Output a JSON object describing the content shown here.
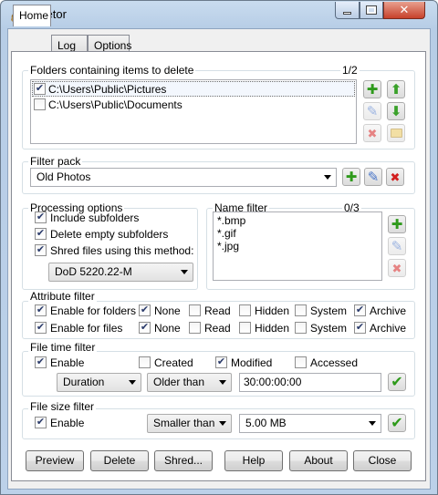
{
  "window": {
    "title": "Deletor"
  },
  "tabs": [
    {
      "label": "Home"
    },
    {
      "label": "Log"
    },
    {
      "label": "Options"
    }
  ],
  "folders": {
    "label": "Folders containing items to delete",
    "count": "1/2",
    "items": [
      {
        "path": "C:\\Users\\Public\\Pictures",
        "checked": true
      },
      {
        "path": "C:\\Users\\Public\\Documents",
        "checked": false
      }
    ]
  },
  "filter_pack": {
    "label": "Filter pack",
    "value": "Old Photos"
  },
  "processing": {
    "label": "Processing options",
    "include_subfolders": {
      "label": "Include subfolders",
      "checked": true
    },
    "delete_empty": {
      "label": "Delete empty subfolders",
      "checked": true
    },
    "shred": {
      "label": "Shred files using this method:",
      "checked": true
    },
    "method": "DoD 5220.22-M"
  },
  "name_filter": {
    "label": "Name filter",
    "count": "0/3",
    "items": [
      "*.bmp",
      "*.gif",
      "*.jpg"
    ]
  },
  "attribute": {
    "label": "Attribute filter",
    "rows": [
      {
        "label": "Enable for folders",
        "enabled": true,
        "none": true,
        "read": false,
        "hidden": false,
        "system": false,
        "archive": true
      },
      {
        "label": "Enable for files",
        "enabled": true,
        "none": true,
        "read": false,
        "hidden": false,
        "system": false,
        "archive": true
      }
    ],
    "labels": {
      "none": "None",
      "read": "Read",
      "hidden": "Hidden",
      "system": "System",
      "archive": "Archive"
    }
  },
  "time_filter": {
    "label": "File time filter",
    "enable": {
      "label": "Enable",
      "checked": true
    },
    "created": {
      "label": "Created",
      "checked": false
    },
    "modified": {
      "label": "Modified",
      "checked": true
    },
    "accessed": {
      "label": "Accessed",
      "checked": false
    },
    "type": "Duration",
    "comparison": "Older than",
    "value": "30:00:00:00"
  },
  "size_filter": {
    "label": "File size filter",
    "enable": {
      "label": "Enable",
      "checked": true
    },
    "comparison": "Smaller than",
    "value": "5.00 MB"
  },
  "buttons": {
    "preview": "Preview",
    "delete": "Delete",
    "shred": "Shred...",
    "help": "Help",
    "about": "About",
    "close": "Close"
  },
  "icons": {
    "check": "✔",
    "plus": "✚",
    "cross": "✖",
    "pencil": "✎",
    "up": "⬆",
    "down": "⬇",
    "confirm": "✔"
  }
}
